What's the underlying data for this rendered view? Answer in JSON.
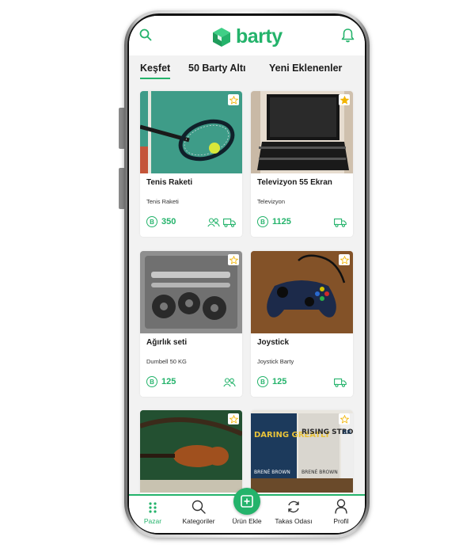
{
  "app": {
    "brand": "barty",
    "accent": "#24b36b"
  },
  "header": {
    "search_icon": "search-icon",
    "bell_icon": "bell-icon"
  },
  "tabs": [
    {
      "label": "Keşfet",
      "active": true
    },
    {
      "label": "50 Barty Altı",
      "active": false
    },
    {
      "label": "Yeni Eklenenler",
      "active": false
    }
  ],
  "products": [
    {
      "title": "Tenis Raketi",
      "subtitle": "Tenis Raketi",
      "price": "350",
      "favorite": false,
      "icons": [
        "people-icon",
        "truck-icon"
      ]
    },
    {
      "title": "Televizyon 55 Ekran",
      "subtitle": "Televizyon",
      "price": "1125",
      "favorite": true,
      "icons": [
        "truck-icon"
      ]
    },
    {
      "title": "Ağırlık seti",
      "subtitle": "Dumbell 50 KG",
      "price": "125",
      "favorite": false,
      "icons": [
        "people-icon"
      ]
    },
    {
      "title": "Joystick",
      "subtitle": "Joystick Barty",
      "price": "125",
      "favorite": false,
      "icons": [
        "truck-icon"
      ]
    },
    {
      "title": "",
      "subtitle": "",
      "price": "",
      "favorite": false,
      "icons": []
    },
    {
      "title": "",
      "subtitle": "",
      "price": "",
      "favorite": false,
      "icons": [],
      "cover_text": [
        "DARING GREATLY",
        "RISING STRONG",
        "BRENÉ BROWN",
        "BRENÉ BROWN",
        "BR WI"
      ]
    }
  ],
  "coin_symbol": "B",
  "nav": [
    {
      "label": "Pazar",
      "icon": "grid-icon",
      "active": true
    },
    {
      "label": "Kategoriler",
      "icon": "search-icon",
      "active": false
    },
    {
      "label": "Ürün Ekle",
      "icon": "add-icon",
      "active": false
    },
    {
      "label": "Takas Odası",
      "icon": "swap-icon",
      "active": false
    },
    {
      "label": "Profil",
      "icon": "user-icon",
      "active": false
    }
  ]
}
